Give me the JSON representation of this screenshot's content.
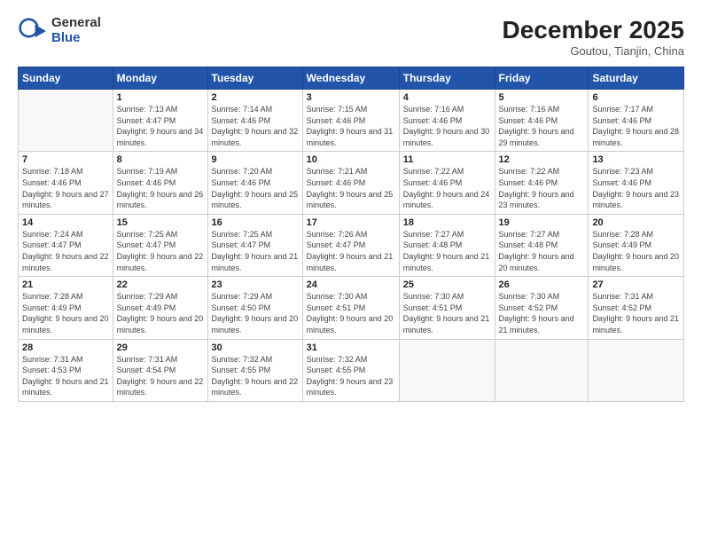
{
  "logo": {
    "general": "General",
    "blue": "Blue"
  },
  "header": {
    "month": "December 2025",
    "location": "Goutou, Tianjin, China"
  },
  "weekdays": [
    "Sunday",
    "Monday",
    "Tuesday",
    "Wednesday",
    "Thursday",
    "Friday",
    "Saturday"
  ],
  "weeks": [
    [
      {
        "day": "",
        "sunrise": "",
        "sunset": "",
        "daylight": ""
      },
      {
        "day": "1",
        "sunrise": "Sunrise: 7:13 AM",
        "sunset": "Sunset: 4:47 PM",
        "daylight": "Daylight: 9 hours and 34 minutes."
      },
      {
        "day": "2",
        "sunrise": "Sunrise: 7:14 AM",
        "sunset": "Sunset: 4:46 PM",
        "daylight": "Daylight: 9 hours and 32 minutes."
      },
      {
        "day": "3",
        "sunrise": "Sunrise: 7:15 AM",
        "sunset": "Sunset: 4:46 PM",
        "daylight": "Daylight: 9 hours and 31 minutes."
      },
      {
        "day": "4",
        "sunrise": "Sunrise: 7:16 AM",
        "sunset": "Sunset: 4:46 PM",
        "daylight": "Daylight: 9 hours and 30 minutes."
      },
      {
        "day": "5",
        "sunrise": "Sunrise: 7:16 AM",
        "sunset": "Sunset: 4:46 PM",
        "daylight": "Daylight: 9 hours and 29 minutes."
      },
      {
        "day": "6",
        "sunrise": "Sunrise: 7:17 AM",
        "sunset": "Sunset: 4:46 PM",
        "daylight": "Daylight: 9 hours and 28 minutes."
      }
    ],
    [
      {
        "day": "7",
        "sunrise": "Sunrise: 7:18 AM",
        "sunset": "Sunset: 4:46 PM",
        "daylight": "Daylight: 9 hours and 27 minutes."
      },
      {
        "day": "8",
        "sunrise": "Sunrise: 7:19 AM",
        "sunset": "Sunset: 4:46 PM",
        "daylight": "Daylight: 9 hours and 26 minutes."
      },
      {
        "day": "9",
        "sunrise": "Sunrise: 7:20 AM",
        "sunset": "Sunset: 4:46 PM",
        "daylight": "Daylight: 9 hours and 25 minutes."
      },
      {
        "day": "10",
        "sunrise": "Sunrise: 7:21 AM",
        "sunset": "Sunset: 4:46 PM",
        "daylight": "Daylight: 9 hours and 25 minutes."
      },
      {
        "day": "11",
        "sunrise": "Sunrise: 7:22 AM",
        "sunset": "Sunset: 4:46 PM",
        "daylight": "Daylight: 9 hours and 24 minutes."
      },
      {
        "day": "12",
        "sunrise": "Sunrise: 7:22 AM",
        "sunset": "Sunset: 4:46 PM",
        "daylight": "Daylight: 9 hours and 23 minutes."
      },
      {
        "day": "13",
        "sunrise": "Sunrise: 7:23 AM",
        "sunset": "Sunset: 4:46 PM",
        "daylight": "Daylight: 9 hours and 23 minutes."
      }
    ],
    [
      {
        "day": "14",
        "sunrise": "Sunrise: 7:24 AM",
        "sunset": "Sunset: 4:47 PM",
        "daylight": "Daylight: 9 hours and 22 minutes."
      },
      {
        "day": "15",
        "sunrise": "Sunrise: 7:25 AM",
        "sunset": "Sunset: 4:47 PM",
        "daylight": "Daylight: 9 hours and 22 minutes."
      },
      {
        "day": "16",
        "sunrise": "Sunrise: 7:25 AM",
        "sunset": "Sunset: 4:47 PM",
        "daylight": "Daylight: 9 hours and 21 minutes."
      },
      {
        "day": "17",
        "sunrise": "Sunrise: 7:26 AM",
        "sunset": "Sunset: 4:47 PM",
        "daylight": "Daylight: 9 hours and 21 minutes."
      },
      {
        "day": "18",
        "sunrise": "Sunrise: 7:27 AM",
        "sunset": "Sunset: 4:48 PM",
        "daylight": "Daylight: 9 hours and 21 minutes."
      },
      {
        "day": "19",
        "sunrise": "Sunrise: 7:27 AM",
        "sunset": "Sunset: 4:48 PM",
        "daylight": "Daylight: 9 hours and 20 minutes."
      },
      {
        "day": "20",
        "sunrise": "Sunrise: 7:28 AM",
        "sunset": "Sunset: 4:49 PM",
        "daylight": "Daylight: 9 hours and 20 minutes."
      }
    ],
    [
      {
        "day": "21",
        "sunrise": "Sunrise: 7:28 AM",
        "sunset": "Sunset: 4:49 PM",
        "daylight": "Daylight: 9 hours and 20 minutes."
      },
      {
        "day": "22",
        "sunrise": "Sunrise: 7:29 AM",
        "sunset": "Sunset: 4:49 PM",
        "daylight": "Daylight: 9 hours and 20 minutes."
      },
      {
        "day": "23",
        "sunrise": "Sunrise: 7:29 AM",
        "sunset": "Sunset: 4:50 PM",
        "daylight": "Daylight: 9 hours and 20 minutes."
      },
      {
        "day": "24",
        "sunrise": "Sunrise: 7:30 AM",
        "sunset": "Sunset: 4:51 PM",
        "daylight": "Daylight: 9 hours and 20 minutes."
      },
      {
        "day": "25",
        "sunrise": "Sunrise: 7:30 AM",
        "sunset": "Sunset: 4:51 PM",
        "daylight": "Daylight: 9 hours and 21 minutes."
      },
      {
        "day": "26",
        "sunrise": "Sunrise: 7:30 AM",
        "sunset": "Sunset: 4:52 PM",
        "daylight": "Daylight: 9 hours and 21 minutes."
      },
      {
        "day": "27",
        "sunrise": "Sunrise: 7:31 AM",
        "sunset": "Sunset: 4:52 PM",
        "daylight": "Daylight: 9 hours and 21 minutes."
      }
    ],
    [
      {
        "day": "28",
        "sunrise": "Sunrise: 7:31 AM",
        "sunset": "Sunset: 4:53 PM",
        "daylight": "Daylight: 9 hours and 21 minutes."
      },
      {
        "day": "29",
        "sunrise": "Sunrise: 7:31 AM",
        "sunset": "Sunset: 4:54 PM",
        "daylight": "Daylight: 9 hours and 22 minutes."
      },
      {
        "day": "30",
        "sunrise": "Sunrise: 7:32 AM",
        "sunset": "Sunset: 4:55 PM",
        "daylight": "Daylight: 9 hours and 22 minutes."
      },
      {
        "day": "31",
        "sunrise": "Sunrise: 7:32 AM",
        "sunset": "Sunset: 4:55 PM",
        "daylight": "Daylight: 9 hours and 23 minutes."
      },
      {
        "day": "",
        "sunrise": "",
        "sunset": "",
        "daylight": ""
      },
      {
        "day": "",
        "sunrise": "",
        "sunset": "",
        "daylight": ""
      },
      {
        "day": "",
        "sunrise": "",
        "sunset": "",
        "daylight": ""
      }
    ]
  ]
}
